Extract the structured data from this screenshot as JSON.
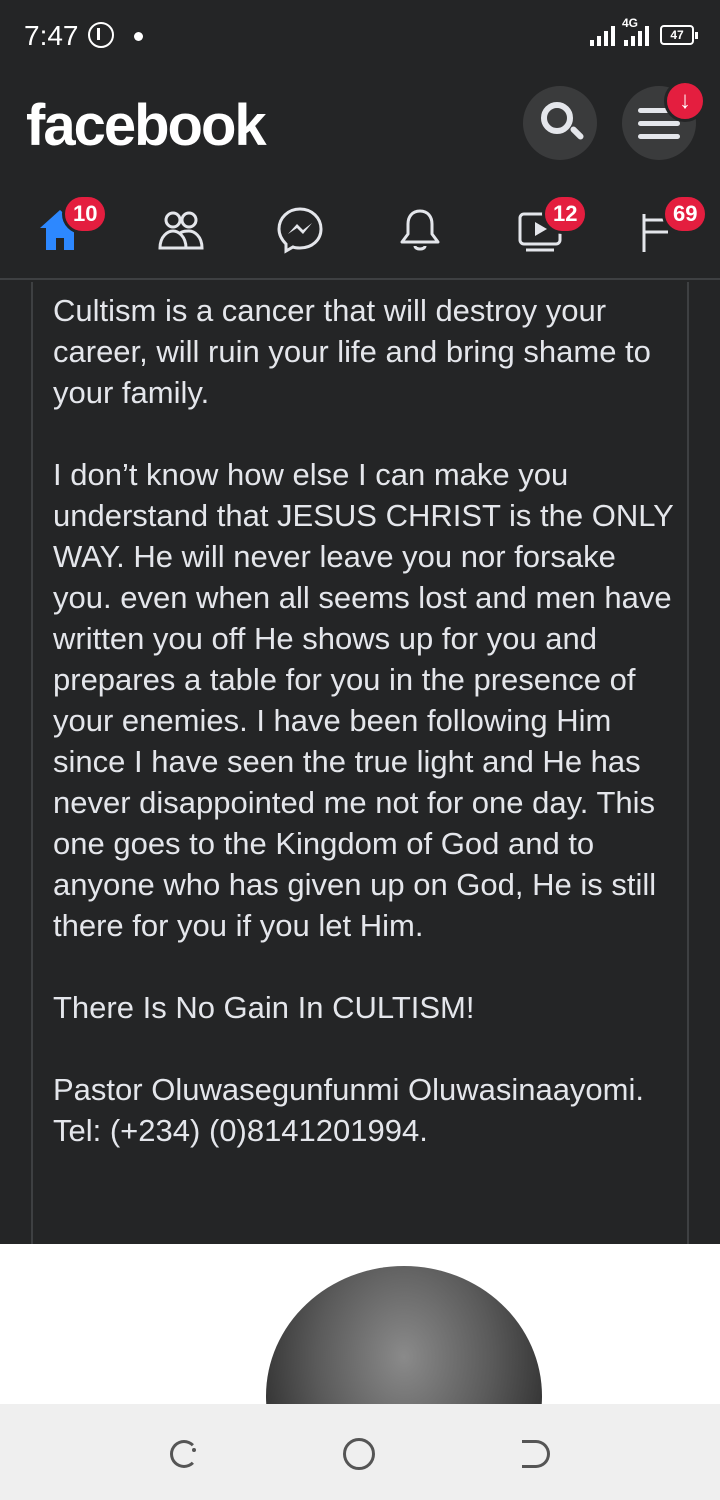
{
  "status_bar": {
    "time": "7:47",
    "network": "4G",
    "battery": "47"
  },
  "header": {
    "logo": "facebook",
    "menu_badge_icon": "download-arrow-icon",
    "menu_badge": "↓"
  },
  "nav": {
    "home_badge": "10",
    "watch_badge": "12",
    "feeds_badge": "69"
  },
  "post": {
    "paragraphs": [
      "Cultism is a cancer that will destroy your career, will ruin your life and bring shame to your family.",
      "I don’t know how else I can make you understand that JESUS CHRIST is the ONLY WAY. He will never leave you nor forsake you. even when all seems lost and men have written you off He shows up for you and prepares a table for you in the presence of your enemies. I have been following Him since I have seen the true light and He has never disappointed me not for one day. This one goes to the Kingdom of God and to anyone who has given up on God, He is still there for you if you let Him.",
      "There Is No Gain In CULTISM!",
      "Pastor Oluwasegunfunmi Oluwasinaayomi.",
      "Tel: (+234) (0)8141201994."
    ]
  },
  "colors": {
    "background": "#242526",
    "badge": "#e41e3f",
    "active_tab": "#2d88ff",
    "text": "#e4e6eb"
  }
}
